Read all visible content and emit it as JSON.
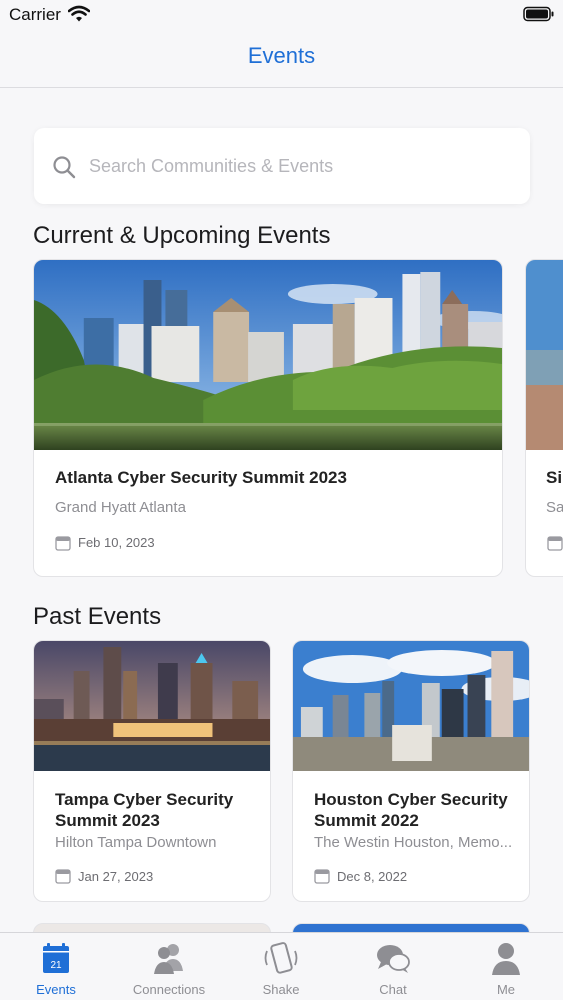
{
  "status_bar": {
    "carrier": "Carrier"
  },
  "nav": {
    "title": "Events"
  },
  "search": {
    "placeholder": "Search Communities & Events"
  },
  "sections": {
    "upcoming": "Current & Upcoming Events",
    "past": "Past Events"
  },
  "upcoming_events": [
    {
      "title": "Atlanta Cyber Security Summit 2023",
      "venue": "Grand Hyatt Atlanta",
      "date": "Feb 10, 2023"
    },
    {
      "title": "Sil",
      "venue": "Sa",
      "date": ""
    }
  ],
  "past_events": [
    {
      "title": "Tampa Cyber Security Summit 2023",
      "venue": "Hilton Tampa Downtown",
      "date": "Jan 27, 2023"
    },
    {
      "title": "Houston Cyber Security Summit 2022",
      "venue": "The Westin Houston, Memo...",
      "date": "Dec  8, 2022"
    }
  ],
  "tabs": [
    {
      "label": "Events",
      "icon": "calendar-icon",
      "badge": "21",
      "active": true
    },
    {
      "label": "Connections",
      "icon": "people-icon"
    },
    {
      "label": "Shake",
      "icon": "phone-shake-icon"
    },
    {
      "label": "Chat",
      "icon": "chat-bubbles-icon"
    },
    {
      "label": "Me",
      "icon": "person-icon"
    }
  ],
  "colors": {
    "accent": "#1f6fd6",
    "background": "#f7f7f9",
    "muted": "#8e8e93"
  }
}
